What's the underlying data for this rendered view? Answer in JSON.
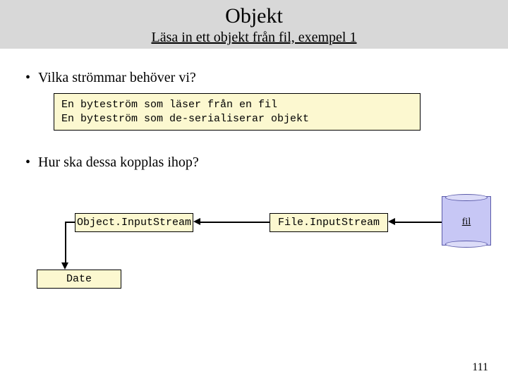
{
  "header": {
    "title": "Objekt",
    "subtitle": "Läsa in ett objekt från fil, exempel 1"
  },
  "bullets": {
    "b1": "Vilka strömmar behöver vi?",
    "b2": "Hur ska dessa kopplas ihop?"
  },
  "codebox": "En byteström som läser från en fil\nEn byteström som de-serialiserar objekt",
  "nodes": {
    "ois": "Object.InputStream",
    "fis": "File.InputStream",
    "date": "Date",
    "file": "fil"
  },
  "pagenum": "111"
}
